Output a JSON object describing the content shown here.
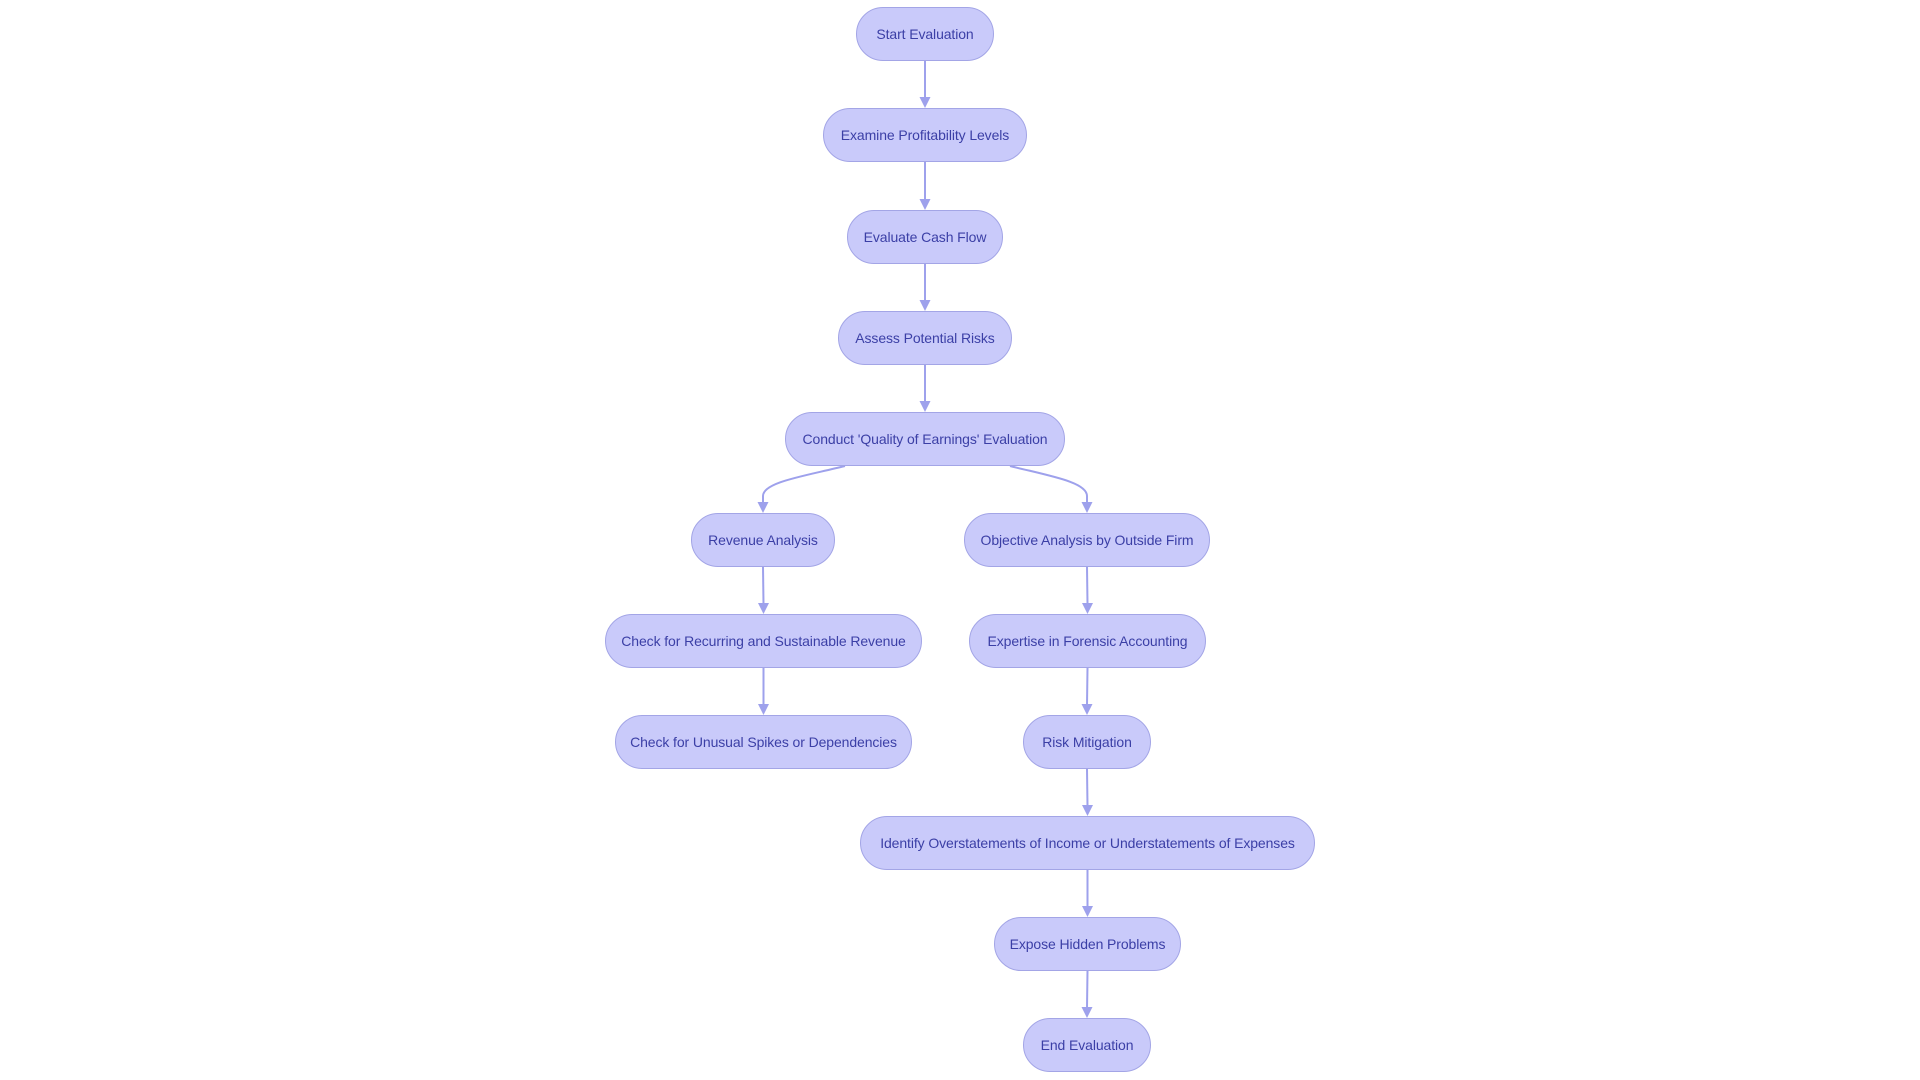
{
  "diagram": {
    "type": "flowchart",
    "direction": "top-down",
    "colors": {
      "node_fill": "#c9cafa",
      "node_border": "#a3a5e6",
      "node_text": "#3b3fa6",
      "edge": "#9ea1ec",
      "background": "#ffffff"
    },
    "nodes": [
      {
        "id": "start",
        "label": "Start Evaluation"
      },
      {
        "id": "profit",
        "label": "Examine Profitability Levels"
      },
      {
        "id": "cash",
        "label": "Evaluate Cash Flow"
      },
      {
        "id": "risks",
        "label": "Assess Potential Risks"
      },
      {
        "id": "qoe",
        "label": "Conduct 'Quality of Earnings' Evaluation"
      },
      {
        "id": "revenue",
        "label": "Revenue Analysis"
      },
      {
        "id": "objective",
        "label": "Objective Analysis by Outside Firm"
      },
      {
        "id": "recurring",
        "label": "Check for Recurring and Sustainable Revenue"
      },
      {
        "id": "forensic",
        "label": "Expertise in Forensic Accounting"
      },
      {
        "id": "spikes",
        "label": "Check for Unusual Spikes or Dependencies"
      },
      {
        "id": "mitigation",
        "label": "Risk Mitigation"
      },
      {
        "id": "overstatements",
        "label": "Identify Overstatements of Income or Understatements of Expenses"
      },
      {
        "id": "hidden",
        "label": "Expose Hidden Problems"
      },
      {
        "id": "end",
        "label": "End Evaluation"
      }
    ],
    "edges": [
      {
        "from": "start",
        "to": "profit"
      },
      {
        "from": "profit",
        "to": "cash"
      },
      {
        "from": "cash",
        "to": "risks"
      },
      {
        "from": "risks",
        "to": "qoe"
      },
      {
        "from": "qoe",
        "to": "revenue"
      },
      {
        "from": "qoe",
        "to": "objective"
      },
      {
        "from": "revenue",
        "to": "recurring"
      },
      {
        "from": "recurring",
        "to": "spikes"
      },
      {
        "from": "objective",
        "to": "forensic"
      },
      {
        "from": "forensic",
        "to": "mitigation"
      },
      {
        "from": "mitigation",
        "to": "overstatements"
      },
      {
        "from": "overstatements",
        "to": "hidden"
      },
      {
        "from": "hidden",
        "to": "end"
      }
    ]
  }
}
